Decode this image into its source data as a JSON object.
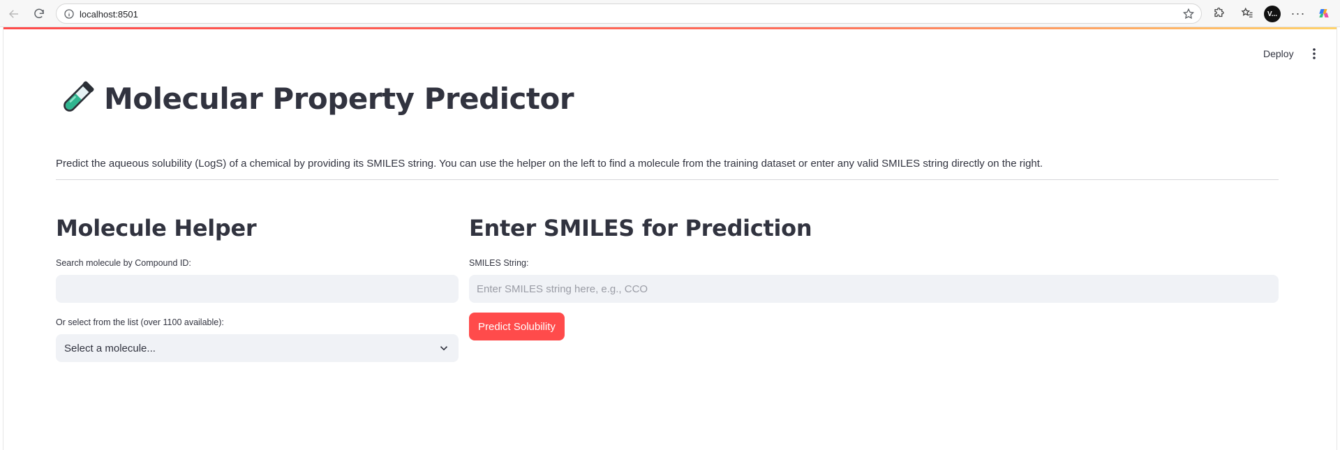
{
  "browser": {
    "url": "localhost:8501",
    "profile_initials": "V..."
  },
  "app": {
    "deploy_label": "Deploy",
    "title": "Molecular Property Predictor",
    "title_icon": "test-tube-icon",
    "description": "Predict the aqueous solubility (LogS) of a chemical by providing its SMILES string. You can use the helper on the left to find a molecule from the training dataset or enter any valid SMILES string directly on the right.",
    "accent_color": "#ff4b4b"
  },
  "helper": {
    "heading": "Molecule Helper",
    "search_label": "Search molecule by Compound ID:",
    "search_value": "",
    "select_label": "Or select from the list (over 1100 available):",
    "select_value": "Select a molecule..."
  },
  "prediction": {
    "heading": "Enter SMILES for Prediction",
    "smiles_label": "SMILES String:",
    "smiles_placeholder": "Enter SMILES string here, e.g., CCO",
    "predict_button": "Predict Solubility"
  }
}
